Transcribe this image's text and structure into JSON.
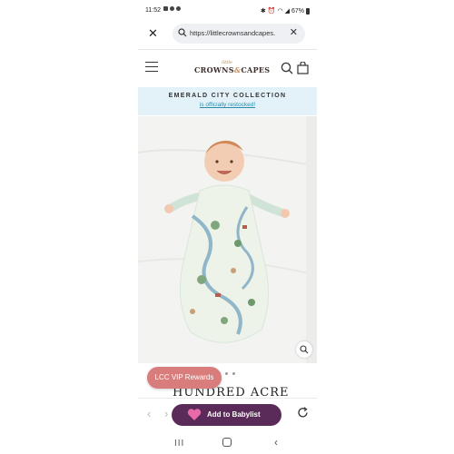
{
  "status_bar": {
    "time": "11:52",
    "battery": "67%"
  },
  "browser": {
    "url": "https://littlecrownsandcapes.",
    "icons": [
      "close-icon",
      "search-icon",
      "clear-icon"
    ]
  },
  "site": {
    "logo_small": "little",
    "logo_main_left": "CROWNS",
    "logo_amp": "&",
    "logo_main_right": "CAPES"
  },
  "banner": {
    "title": "EMERALD CITY COLLECTION",
    "subtitle": "is officially restocked!",
    "color": "#e3f2f9"
  },
  "product": {
    "title": "HUNDRED ACRE",
    "image_count": 3
  },
  "vip_button": {
    "label": "LCC VIP Rewards",
    "color": "#d97c7c"
  },
  "toolbar": {
    "babylist_label": "Add to Babylist",
    "babylist_color": "#5a2a59",
    "back_icon": "chevron-left-icon",
    "forward_icon": "chevron-right-icon",
    "reload_icon": "reload-icon"
  },
  "android_nav": [
    "recents-icon",
    "home-icon",
    "back-icon"
  ]
}
